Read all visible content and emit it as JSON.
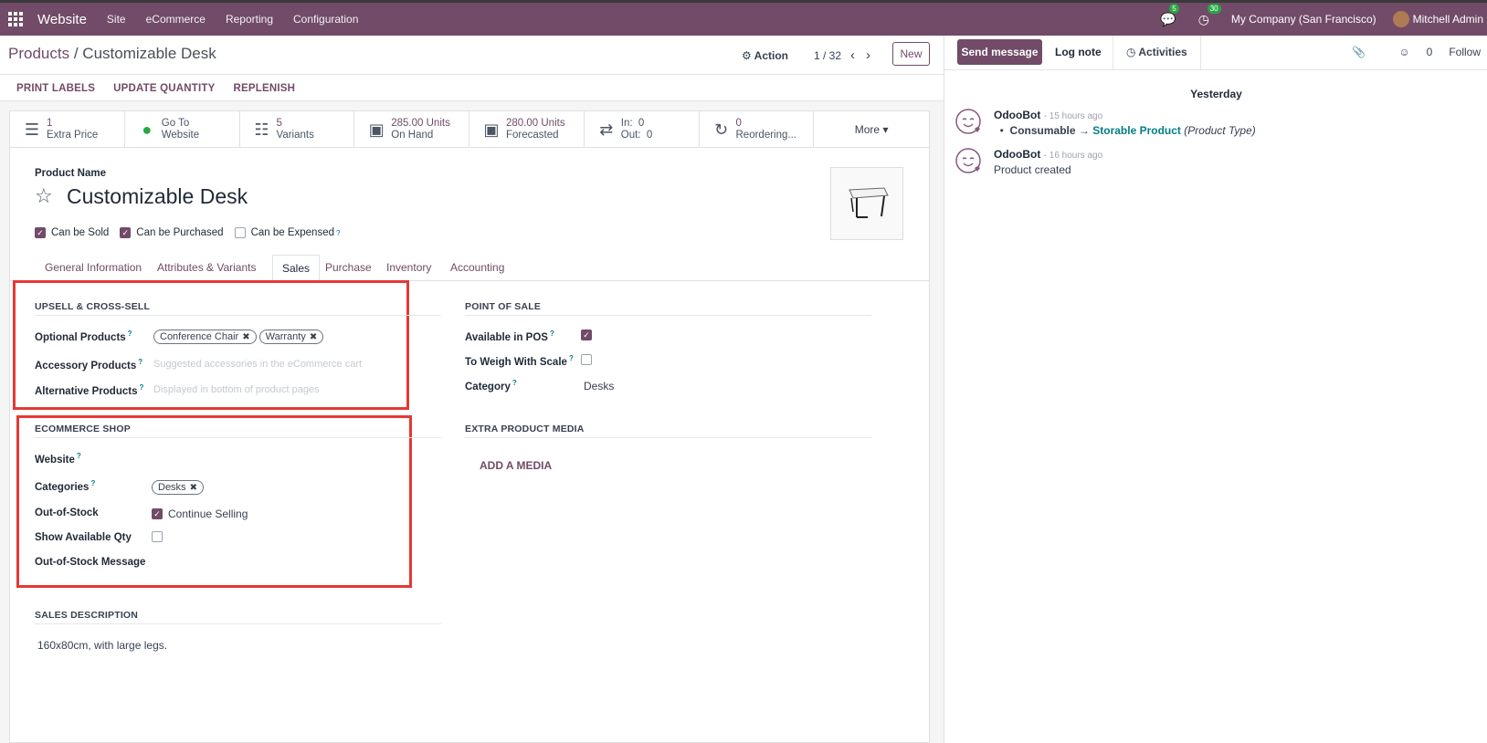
{
  "topbar": {
    "app_name": "Website",
    "menus": [
      "Site",
      "eCommerce",
      "Reporting",
      "Configuration"
    ],
    "messages_count": "5",
    "activities_count": "30",
    "company": "My Company (San Francisco)",
    "user": "Mitchell Admin"
  },
  "breadcrumb": {
    "parent": "Products",
    "separator": "/",
    "current": "Customizable Desk"
  },
  "control": {
    "action_label": "Action",
    "pager": "1 / 32",
    "new_label": "New"
  },
  "statusbar": {
    "buttons": [
      "PRINT LABELS",
      "UPDATE QUANTITY",
      "REPLENISH"
    ]
  },
  "smart_buttons": [
    {
      "icon": "list-icon",
      "value": "1",
      "label": "Extra Price"
    },
    {
      "icon": "globe-icon",
      "value": "Go To",
      "label": "Website"
    },
    {
      "icon": "sitemap-icon",
      "value": "5",
      "label": "Variants"
    },
    {
      "icon": "cubes-icon",
      "value": "285.00 Units",
      "label": "On Hand"
    },
    {
      "icon": "cubes-icon",
      "value": "280.00 Units",
      "label": "Forecasted"
    },
    {
      "icon": "exchange-icon",
      "value": "In:  0",
      "label": "Out:  0"
    },
    {
      "icon": "refresh-icon",
      "value": "0",
      "label": "Reordering..."
    }
  ],
  "more_label": "More",
  "product": {
    "name_label": "Product Name",
    "name": "Customizable Desk",
    "checks": [
      {
        "label": "Can be Sold",
        "checked": true
      },
      {
        "label": "Can be Purchased",
        "checked": true
      },
      {
        "label": "Can be Expensed",
        "checked": false
      }
    ]
  },
  "tabs": [
    "General Information",
    "Attributes & Variants",
    "Sales",
    "Purchase",
    "Inventory",
    "Accounting"
  ],
  "active_tab": "Sales",
  "upsell": {
    "title": "UPSELL & CROSS-SELL",
    "optional_label": "Optional Products",
    "optional_tags": [
      "Conference Chair",
      "Warranty"
    ],
    "accessory_label": "Accessory Products",
    "accessory_placeholder": "Suggested accessories in the eCommerce cart",
    "alternative_label": "Alternative Products",
    "alternative_placeholder": "Displayed in bottom of product pages"
  },
  "ecommerce": {
    "title": "ECOMMERCE SHOP",
    "website_label": "Website",
    "categories_label": "Categories",
    "categories_tags": [
      "Desks"
    ],
    "oos_label": "Out-of-Stock",
    "oos_value": "Continue Selling",
    "show_qty_label": "Show Available Qty",
    "oos_message_label": "Out-of-Stock Message"
  },
  "pos": {
    "title": "POINT OF SALE",
    "available_label": "Available in POS",
    "weigh_label": "To Weigh With Scale",
    "category_label": "Category",
    "category_value": "Desks"
  },
  "media": {
    "title": "EXTRA PRODUCT MEDIA",
    "add_label": "ADD A MEDIA"
  },
  "sales_description": {
    "title": "SALES DESCRIPTION",
    "text": "160x80cm, with large legs."
  },
  "chatter": {
    "send_message": "Send message",
    "log_note": "Log note",
    "activities": "Activities",
    "followers_count": "0",
    "follow": "Follow",
    "day": "Yesterday",
    "messages": [
      {
        "author": "OdooBot",
        "time": "- 15 hours ago",
        "old": "Consumable",
        "arrow": "→",
        "new": "Storable Product",
        "field": "(Product Type)"
      },
      {
        "author": "OdooBot",
        "time": "- 16 hours ago",
        "text": "Product created"
      }
    ]
  }
}
